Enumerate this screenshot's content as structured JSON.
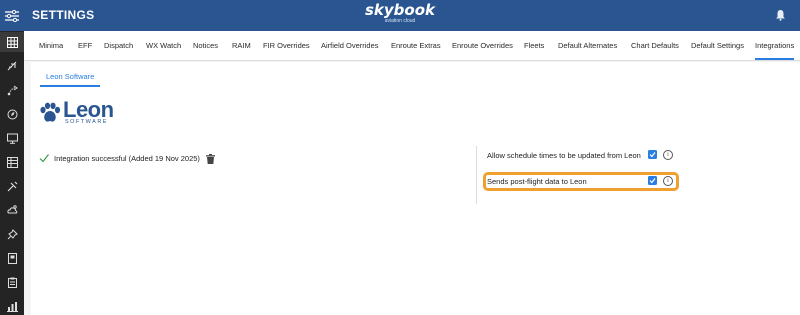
{
  "header": {
    "title": "SETTINGS",
    "brand": "skybook",
    "brand_tagline": "aviation cloud",
    "menu_icon": "settings-sliders-icon",
    "notification_icon": "bell-icon",
    "bar_color": "#2a5591"
  },
  "sidebar": {
    "items": [
      {
        "icon": "grid-icon",
        "active": true
      },
      {
        "icon": "plane-icon"
      },
      {
        "icon": "route-icon"
      },
      {
        "icon": "compass-icon"
      },
      {
        "icon": "monitor-icon"
      },
      {
        "icon": "table-icon"
      },
      {
        "icon": "tools-icon"
      },
      {
        "icon": "weather-icon"
      },
      {
        "icon": "pin-icon"
      },
      {
        "icon": "book-icon"
      },
      {
        "icon": "clipboard-icon"
      },
      {
        "icon": "bar-chart-icon"
      }
    ]
  },
  "tabs": [
    {
      "label": "Minima"
    },
    {
      "label": "EFF"
    },
    {
      "label": "Dispatch"
    },
    {
      "label": "WX Watch"
    },
    {
      "label": "Notices"
    },
    {
      "label": "RAIM"
    },
    {
      "label": "FIR Overrides"
    },
    {
      "label": "Airfield Overrides"
    },
    {
      "label": "Enroute Extras"
    },
    {
      "label": "Enroute Overrides"
    },
    {
      "label": "Fleets"
    },
    {
      "label": "Default Alternates"
    },
    {
      "label": "Chart Defaults"
    },
    {
      "label": "Default Settings"
    },
    {
      "label": "Integrations",
      "active": true
    }
  ],
  "integration": {
    "subtab": "Leon Software",
    "logo_name": "Leon",
    "logo_sub": "SOFTWARE",
    "status_text": "Integration successful (Added 19 Nov 2025)",
    "status_icon": "check-icon",
    "delete_icon": "trash-icon",
    "options": [
      {
        "label": "Allow schedule times to be updated from Leon",
        "checked": true,
        "info_icon": "info-icon"
      },
      {
        "label": "Sends post-flight data to Leon",
        "checked": true,
        "info_icon": "info-icon",
        "highlighted": true
      }
    ]
  },
  "colors": {
    "accent": "#2a7de1",
    "highlight": "#f0a030",
    "success": "#3a9a4a"
  }
}
